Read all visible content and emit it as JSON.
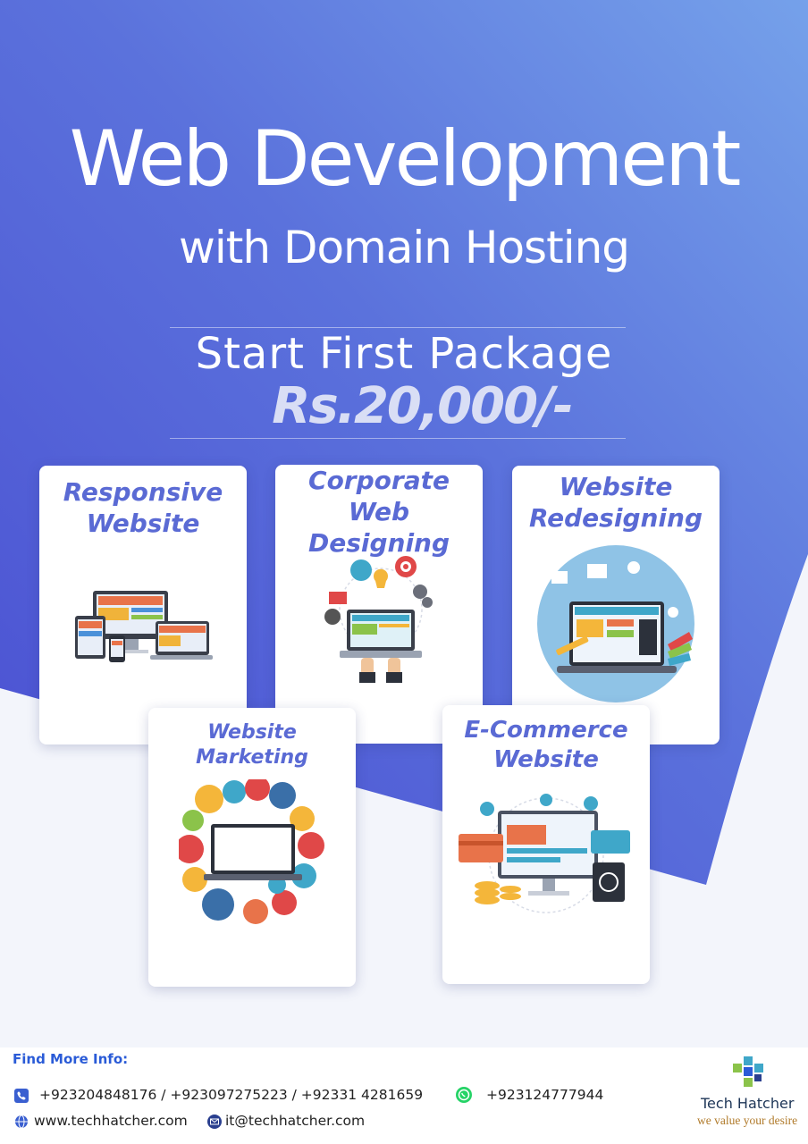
{
  "header": {
    "title": "Web Development",
    "subtitle": "with Domain Hosting"
  },
  "package": {
    "label": "Start First Package",
    "price": "Rs.20,000/-"
  },
  "services": {
    "responsive": {
      "line1": "Responsive",
      "line2": "Website"
    },
    "corporate": {
      "line1": "Corporate",
      "line2": "Web Designing"
    },
    "redesign": {
      "line1": "Website",
      "line2": "Redesigning"
    },
    "marketing": {
      "line1": "Website Marketing"
    },
    "ecommerce": {
      "line1": "E-Commerce",
      "line2": "Website"
    }
  },
  "footer": {
    "heading": "Find More Info:",
    "phones": "+923204848176 / +923097275223 / +92331 4281659",
    "whatsapp": "+923124777944",
    "website": "www.techhatcher.com",
    "email": "it@techhatcher.com",
    "brand_name": "Tech Hatcher",
    "brand_tagline": "we value your desire"
  },
  "colors": {
    "background_gradient": [
      "#4a55d6",
      "#6f9ae6"
    ],
    "accent_title": "#5a6ad4",
    "footer_heading": "#2a5bd7",
    "whatsapp": "#25d366"
  },
  "icons": [
    "phone-icon",
    "whatsapp-icon",
    "globe-icon",
    "email-icon",
    "tech-hatcher-logo"
  ]
}
